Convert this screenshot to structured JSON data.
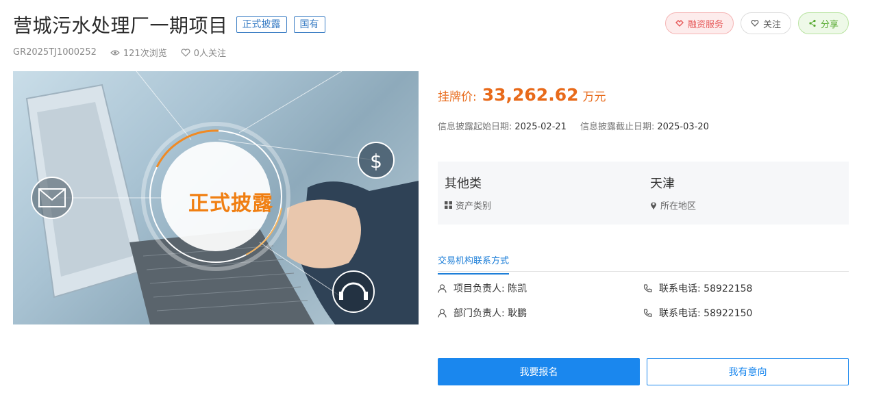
{
  "header": {
    "title": "营城污水处理厂一期项目",
    "tags": [
      "正式披露",
      "国有"
    ]
  },
  "actions": {
    "finance": "融资服务",
    "follow": "关注",
    "share": "分享"
  },
  "meta": {
    "code": "GR2025TJ1000252",
    "views": "121次浏览",
    "followers": "0人关注"
  },
  "hero": {
    "text": "正式披露"
  },
  "price": {
    "label": "挂牌价:",
    "value": "33,262.62",
    "unit": "万元"
  },
  "dates": {
    "start_label": "信息披露起始日期:",
    "start_value": "2025-02-21",
    "end_label": "信息披露截止日期:",
    "end_value": "2025-03-20"
  },
  "info": {
    "asset_type_value": "其他类",
    "asset_type_label": "资产类别",
    "region_value": "天津",
    "region_label": "所在地区"
  },
  "contact": {
    "tab": "交易机构联系方式",
    "project_manager": "项目负责人: 陈凯",
    "project_phone": "联系电话: 58922158",
    "dept_manager": "部门负责人: 耿鹏",
    "dept_phone": "联系电话: 58922150"
  },
  "buttons": {
    "register": "我要报名",
    "intent": "我有意向"
  },
  "colors": {
    "accent": "#1a87ee",
    "price": "#e86a1a",
    "tag": "#3d7fc5"
  }
}
